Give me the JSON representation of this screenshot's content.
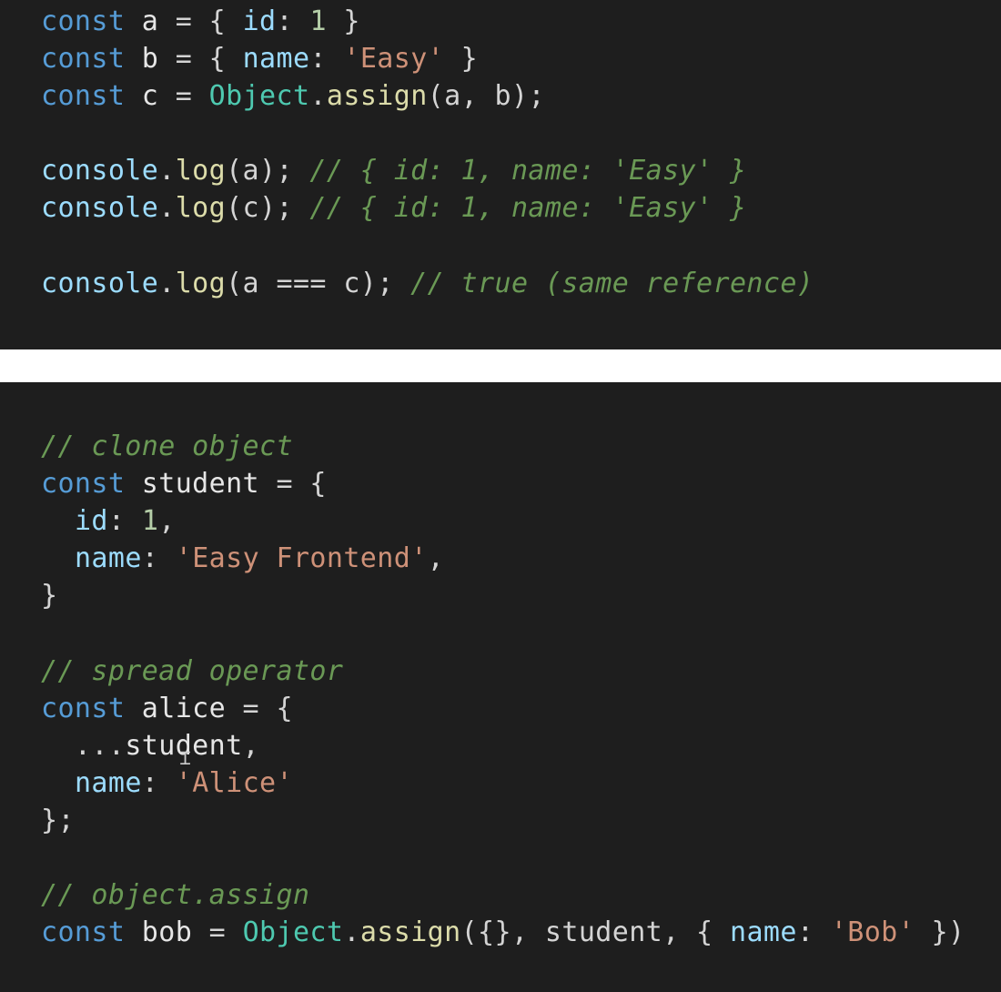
{
  "top_panel": {
    "lines": [
      [
        {
          "t": "kw",
          "v": "const"
        },
        {
          "t": "punc",
          "v": " "
        },
        {
          "t": "var",
          "v": "a"
        },
        {
          "t": "punc",
          "v": " = { "
        },
        {
          "t": "prop",
          "v": "id"
        },
        {
          "t": "punc",
          "v": ": "
        },
        {
          "t": "num",
          "v": "1"
        },
        {
          "t": "punc",
          "v": " }"
        }
      ],
      [
        {
          "t": "kw",
          "v": "const"
        },
        {
          "t": "punc",
          "v": " "
        },
        {
          "t": "var",
          "v": "b"
        },
        {
          "t": "punc",
          "v": " = { "
        },
        {
          "t": "prop",
          "v": "name"
        },
        {
          "t": "punc",
          "v": ": "
        },
        {
          "t": "str",
          "v": "'Easy'"
        },
        {
          "t": "punc",
          "v": " }"
        }
      ],
      [
        {
          "t": "kw",
          "v": "const"
        },
        {
          "t": "punc",
          "v": " "
        },
        {
          "t": "var",
          "v": "c"
        },
        {
          "t": "punc",
          "v": " = "
        },
        {
          "t": "obj",
          "v": "Object"
        },
        {
          "t": "punc",
          "v": "."
        },
        {
          "t": "fn",
          "v": "assign"
        },
        {
          "t": "punc",
          "v": "(a, b);"
        }
      ],
      [],
      [
        {
          "t": "console",
          "v": "console"
        },
        {
          "t": "punc",
          "v": "."
        },
        {
          "t": "fn",
          "v": "log"
        },
        {
          "t": "punc",
          "v": "(a); "
        },
        {
          "t": "comment",
          "v": "// { id: 1, name: 'Easy' }"
        }
      ],
      [
        {
          "t": "console",
          "v": "console"
        },
        {
          "t": "punc",
          "v": "."
        },
        {
          "t": "fn",
          "v": "log"
        },
        {
          "t": "punc",
          "v": "(c); "
        },
        {
          "t": "comment",
          "v": "// { id: 1, name: 'Easy' }"
        }
      ],
      [],
      [
        {
          "t": "console",
          "v": "console"
        },
        {
          "t": "punc",
          "v": "."
        },
        {
          "t": "fn",
          "v": "log"
        },
        {
          "t": "punc",
          "v": "(a === c); "
        },
        {
          "t": "comment",
          "v": "// true (same reference)"
        }
      ]
    ]
  },
  "bottom_panel": {
    "lines": [
      [
        {
          "t": "comment",
          "v": "// clone object"
        }
      ],
      [
        {
          "t": "kw",
          "v": "const"
        },
        {
          "t": "punc",
          "v": " "
        },
        {
          "t": "var",
          "v": "student"
        },
        {
          "t": "punc",
          "v": " = {"
        }
      ],
      [
        {
          "t": "punc",
          "v": "  "
        },
        {
          "t": "prop",
          "v": "id"
        },
        {
          "t": "punc",
          "v": ": "
        },
        {
          "t": "num",
          "v": "1"
        },
        {
          "t": "punc",
          "v": ","
        }
      ],
      [
        {
          "t": "punc",
          "v": "  "
        },
        {
          "t": "prop",
          "v": "name"
        },
        {
          "t": "punc",
          "v": ": "
        },
        {
          "t": "str",
          "v": "'Easy Frontend'"
        },
        {
          "t": "punc",
          "v": ","
        }
      ],
      [
        {
          "t": "punc",
          "v": "}"
        }
      ],
      [],
      [
        {
          "t": "comment",
          "v": "// spread operator"
        }
      ],
      [
        {
          "t": "kw",
          "v": "const"
        },
        {
          "t": "punc",
          "v": " "
        },
        {
          "t": "var",
          "v": "alice"
        },
        {
          "t": "punc",
          "v": " = {"
        }
      ],
      [
        {
          "t": "punc",
          "v": "  ..."
        },
        {
          "t": "var",
          "v": "student"
        },
        {
          "t": "punc",
          "v": ","
        }
      ],
      [
        {
          "t": "punc",
          "v": "  "
        },
        {
          "t": "prop",
          "v": "name"
        },
        {
          "t": "punc",
          "v": ": "
        },
        {
          "t": "str",
          "v": "'Alice'"
        }
      ],
      [
        {
          "t": "punc",
          "v": "};"
        }
      ],
      [],
      [
        {
          "t": "comment",
          "v": "// object.assign"
        }
      ],
      [
        {
          "t": "kw",
          "v": "const"
        },
        {
          "t": "punc",
          "v": " "
        },
        {
          "t": "var",
          "v": "bob"
        },
        {
          "t": "punc",
          "v": " = "
        },
        {
          "t": "obj",
          "v": "Object"
        },
        {
          "t": "punc",
          "v": "."
        },
        {
          "t": "fn",
          "v": "assign"
        },
        {
          "t": "punc",
          "v": "({}, student, { "
        },
        {
          "t": "prop",
          "v": "name"
        },
        {
          "t": "punc",
          "v": ": "
        },
        {
          "t": "str",
          "v": "'Bob'"
        },
        {
          "t": "punc",
          "v": " })"
        }
      ]
    ]
  },
  "colors": {
    "background": "#1e1e1e",
    "separator": "#ffffff",
    "keyword": "#569cd6",
    "string": "#ce9178",
    "number": "#b5cea8",
    "comment": "#6a9955",
    "function": "#dcdcaa"
  },
  "cursor_icon": "i-beam-cursor-icon"
}
